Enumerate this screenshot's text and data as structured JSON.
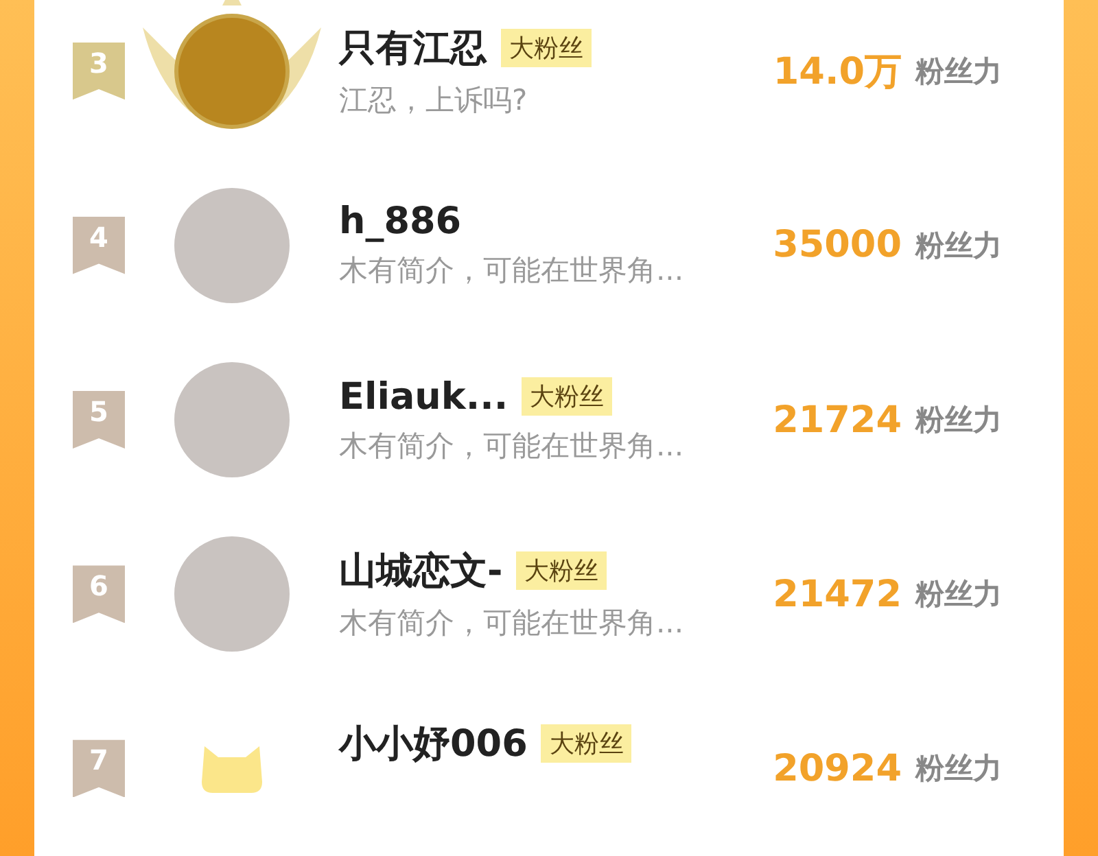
{
  "rows": [
    {
      "rank": "3",
      "color": "#d8c88c",
      "kind": "framed-photo",
      "name": "只有江忍",
      "badge": "大粉丝",
      "bio": "江忍，上诉吗?",
      "amount": "14.0万",
      "unit": "粉丝力"
    },
    {
      "rank": "4",
      "color": "#cdbcac",
      "kind": "photo",
      "name": "h_886",
      "bio": "木有简介，可能在世界角...",
      "amount": "35000",
      "unit": "粉丝力"
    },
    {
      "rank": "5",
      "color": "#cdbcac",
      "kind": "photo",
      "name": "Eliauk...",
      "badge": "大粉丝",
      "bio": "木有简介，可能在世界角...",
      "amount": "21724",
      "unit": "粉丝力"
    },
    {
      "rank": "6",
      "color": "#cdbcac",
      "kind": "photo",
      "name": "山城恋文-",
      "badge": "大粉丝",
      "bio": "木有简介，可能在世界角...",
      "amount": "21472",
      "unit": "粉丝力"
    },
    {
      "rank": "7",
      "color": "#cdbcac",
      "kind": "cat",
      "name": "小小妤006",
      "badge": "大粉丝",
      "amount": "20924",
      "unit": "粉丝力"
    }
  ]
}
